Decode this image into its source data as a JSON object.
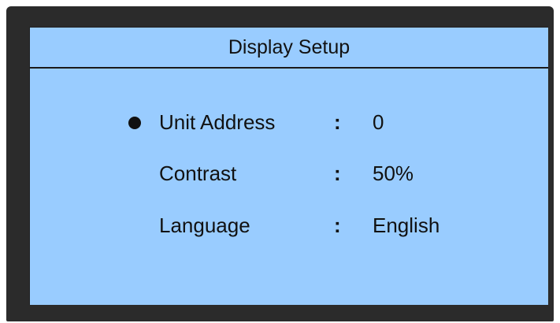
{
  "screen": {
    "title": "Display Setup",
    "items": [
      {
        "label": "Unit Address",
        "separator": ":",
        "value": "0",
        "selected": true
      },
      {
        "label": "Contrast",
        "separator": ":",
        "value": "50%",
        "selected": false
      },
      {
        "label": "Language",
        "separator": ":",
        "value": "English",
        "selected": false
      }
    ]
  },
  "colors": {
    "bezel": "#2b2b2b",
    "screen_background": "#99ccff",
    "text": "#111111"
  },
  "icons": {
    "selection_marker": "bullet-icon"
  }
}
